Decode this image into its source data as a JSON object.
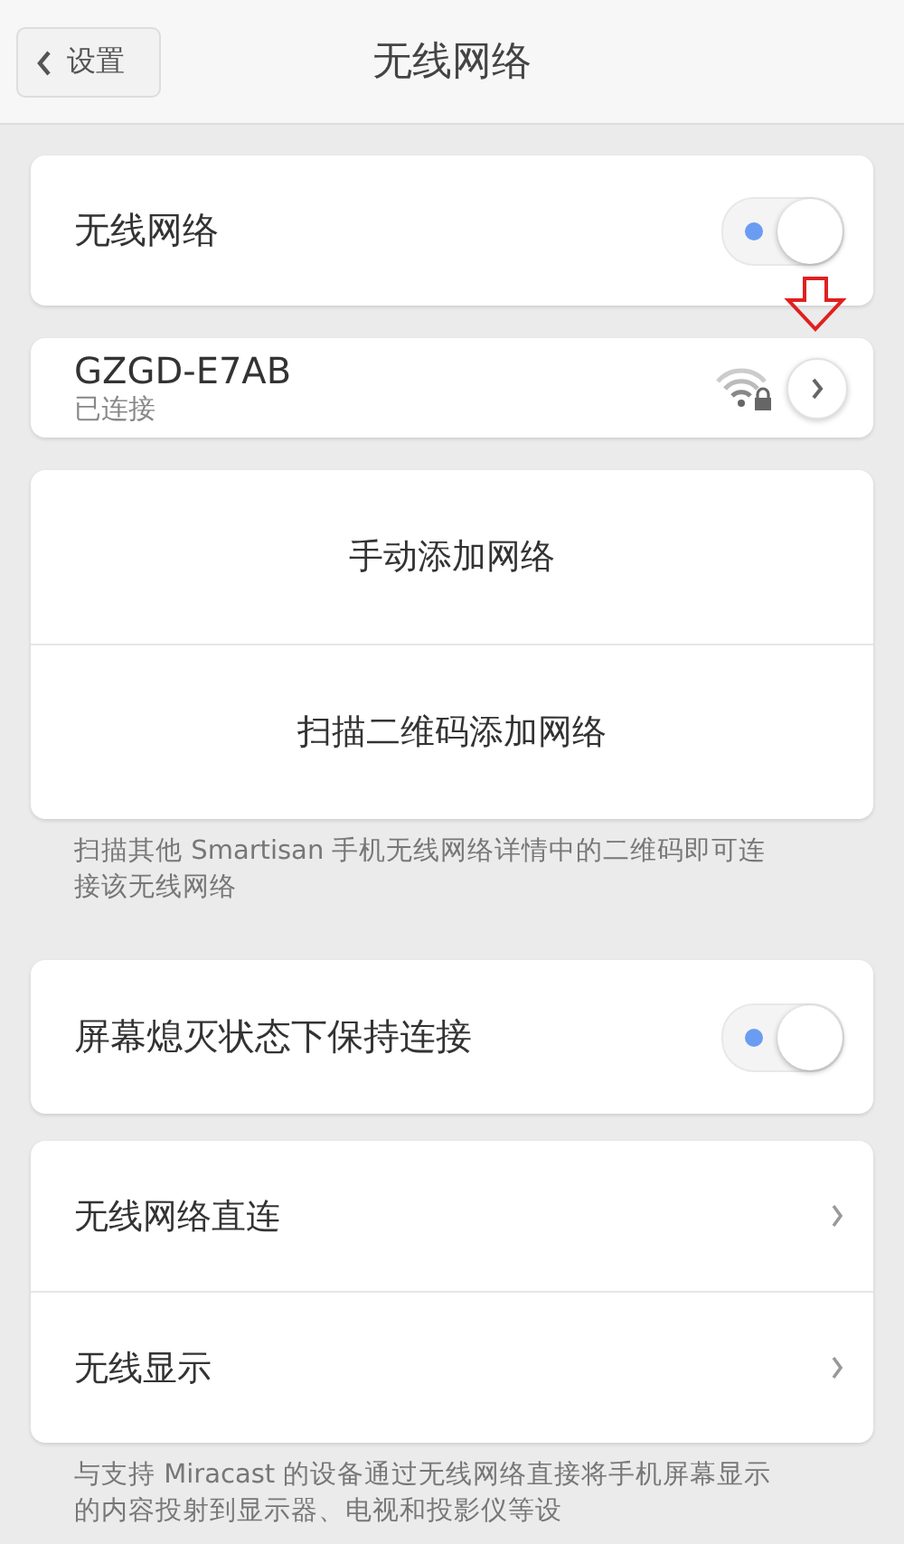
{
  "header": {
    "back": "设置",
    "title": "无线网络"
  },
  "wifi_toggle": {
    "label": "无线网络",
    "on": true
  },
  "connected_network": {
    "name": "GZGD-E7AB",
    "status": "已连接",
    "locked": true
  },
  "add_actions": [
    "手动添加网络",
    "扫描二维码添加网络"
  ],
  "add_note": "扫描其他 Smartisan 手机无线网络详情中的二维码即可连接该无线网络",
  "keep_connected": {
    "label": "屏幕熄灭状态下保持连接",
    "on": true
  },
  "links": [
    "无线网络直连",
    "无线显示"
  ],
  "display_note": "与支持 Miracast 的设备通过无线网络直接将手机屏幕显示的内容投射到显示器、电视和投影仪等设"
}
